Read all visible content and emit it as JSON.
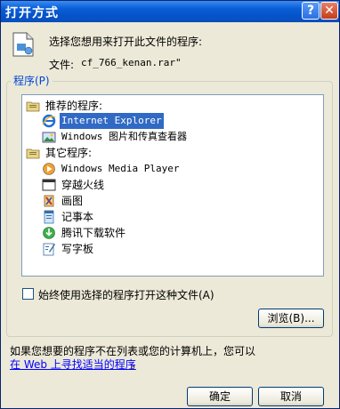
{
  "window": {
    "title": "打开方式",
    "help_label": "?",
    "close_label": "✕"
  },
  "header": {
    "description": "选择您想用来打开此文件的程序:",
    "file_label": "文件:",
    "file_name": "cf_766_kenan.rar\""
  },
  "programs": {
    "legend": "程序(P)",
    "groups": [
      {
        "label": "推荐的程序:",
        "icon": "folder-icon",
        "items": [
          {
            "label": "Internet Explorer",
            "icon": "internet-explorer-icon",
            "selected": true
          },
          {
            "label": "Windows 图片和传真查看器",
            "icon": "picture-viewer-icon",
            "selected": false
          }
        ]
      },
      {
        "label": "其它程序:",
        "icon": "folder-icon",
        "items": [
          {
            "label": "Windows Media Player",
            "icon": "media-player-icon",
            "selected": false
          },
          {
            "label": "穿越火线",
            "icon": "crossfire-icon",
            "selected": false
          },
          {
            "label": "画图",
            "icon": "paint-icon",
            "selected": false
          },
          {
            "label": "记事本",
            "icon": "notepad-icon",
            "selected": false
          },
          {
            "label": "腾讯下载软件",
            "icon": "tencent-download-icon",
            "selected": false
          },
          {
            "label": "写字板",
            "icon": "wordpad-icon",
            "selected": false
          }
        ]
      }
    ]
  },
  "always_use": {
    "label": "始终使用选择的程序打开这种文件(A)",
    "checked": false
  },
  "buttons": {
    "browse": "浏览(B)...",
    "ok": "确定",
    "cancel": "取消"
  },
  "footer": {
    "text": "如果您想要的程序不在列表或您的计算机上，您可以",
    "link": "在 Web 上寻找适当的程序",
    "link_tail": "。"
  },
  "colors": {
    "titlebar": "#0a5fd8",
    "dialog_bg": "#ece9d8",
    "selection": "#316ac5",
    "link": "#0000ff"
  }
}
